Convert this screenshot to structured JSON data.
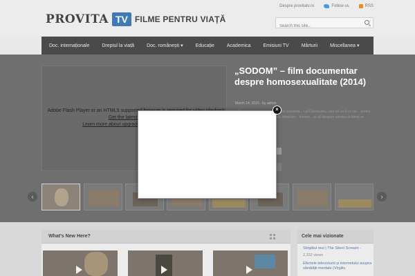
{
  "header": {
    "logo_word": "PROVITA",
    "logo_tv": "TV",
    "logo_tagline": "FILME PENTRU VIAȚĂ",
    "top_links": [
      "Despre provitatv.ro",
      "Follow us",
      "RSS"
    ],
    "search_placeholder": "Search this site..."
  },
  "nav": {
    "items": [
      "Doc. internaționale",
      "Dreptul la viață",
      "Doc. românești ▾",
      "Educație",
      "Academica",
      "Emisiuni TV",
      "Mărturii",
      "Miscellanea ▾"
    ]
  },
  "featured": {
    "flash_message": "Adobe Flash Player or an HTML5 supported browser is required for video playback.",
    "flash_link1": "Get the latest Flash Player",
    "flash_link2": "Learn more about upgrading to an HTML5 browser",
    "title": "„SODOM” – film documentar despre homosexualitate (2014)",
    "meta": "March 14, 2015 · by admin",
    "excerpt": "...film documentar pe care îl vom prezenta... Lui Dumnezeu, care vă va fi cu noi... pentru binele nostru, datoria noastră, admirăm... frumos... și vă atragem atenția că filmul ce urmează..."
  },
  "lightbox": {
    "close_glyph": "×"
  },
  "slider": {
    "prev_glyph": "‹",
    "next_glyph": "›"
  },
  "whats_new": {
    "title": "What's New Here?"
  },
  "most_viewed": {
    "title": "Cele mai vizionate",
    "items": [
      {
        "title": "Strigătul mut | The Silent Scream -",
        "views": "2,332 views"
      },
      {
        "title": "Efectele televiziunii și internetului asupra sănătății mentale (Virgiliu",
        "views": ""
      }
    ]
  },
  "colors": {
    "nav_bg": "#4a4a4a",
    "logo_tv_bg": "#3f7ab6",
    "overlay_dark": "#6f6f6f",
    "link_blue": "#5577aa"
  }
}
